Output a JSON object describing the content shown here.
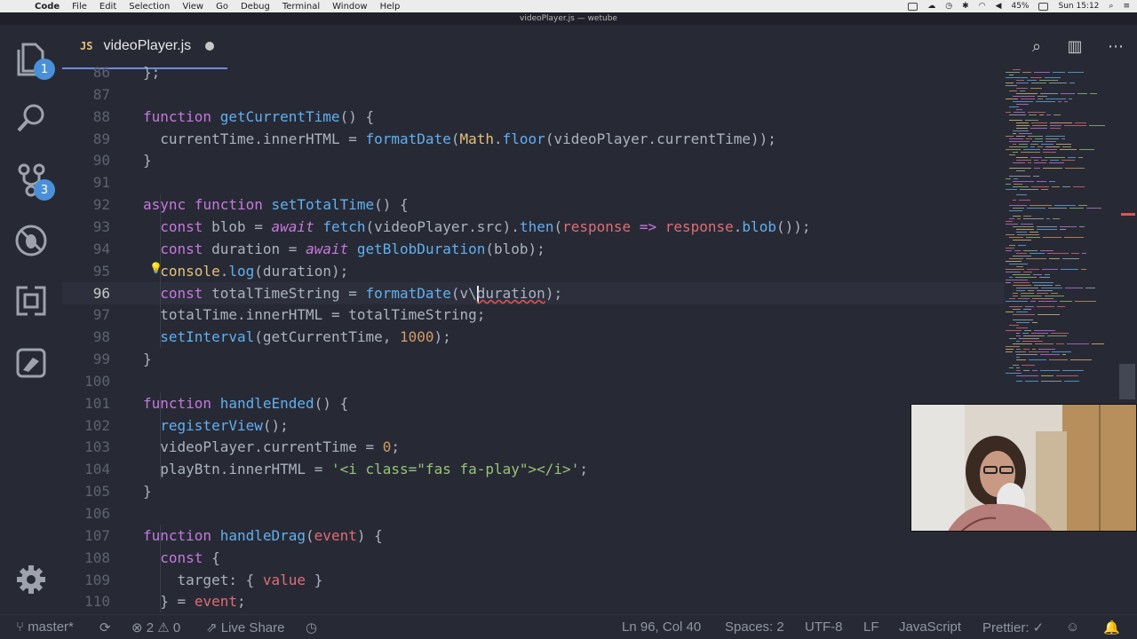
{
  "menubar": {
    "app": "Code",
    "items": [
      "File",
      "Edit",
      "Selection",
      "View",
      "Go",
      "Debug",
      "Terminal",
      "Window",
      "Help"
    ],
    "battery": "45%",
    "clock": "Sun 15:12"
  },
  "window_title": "videoPlayer.js — wetube",
  "tab": {
    "icon_label": "JS",
    "filename": "videoPlayer.js"
  },
  "activity": {
    "explorer_badge": "1",
    "scm_badge": "3"
  },
  "code_lines": [
    {
      "num": "86",
      "text": "};"
    },
    {
      "num": "87",
      "text": ""
    },
    {
      "num": "88",
      "text": "function getCurrentTime() {"
    },
    {
      "num": "89",
      "text": "  currentTime.innerHTML = formatDate(Math.floor(videoPlayer.currentTime));"
    },
    {
      "num": "90",
      "text": "}"
    },
    {
      "num": "91",
      "text": ""
    },
    {
      "num": "92",
      "text": "async function setTotalTime() {"
    },
    {
      "num": "93",
      "text": "  const blob = await fetch(videoPlayer.src).then(response => response.blob());"
    },
    {
      "num": "94",
      "text": "  const duration = await getBlobDuration(blob);"
    },
    {
      "num": "95",
      "text": "  console.log(duration);"
    },
    {
      "num": "96",
      "text": "  const totalTimeString = formatDate(v\\duration);"
    },
    {
      "num": "97",
      "text": "  totalTime.innerHTML = totalTimeString;"
    },
    {
      "num": "98",
      "text": "  setInterval(getCurrentTime, 1000);"
    },
    {
      "num": "99",
      "text": "}"
    },
    {
      "num": "100",
      "text": ""
    },
    {
      "num": "101",
      "text": "function handleEnded() {"
    },
    {
      "num": "102",
      "text": "  registerView();"
    },
    {
      "num": "103",
      "text": "  videoPlayer.currentTime = 0;"
    },
    {
      "num": "104",
      "text": "  playBtn.innerHTML = '<i class=\"fas fa-play\"></i>';"
    },
    {
      "num": "105",
      "text": "}"
    },
    {
      "num": "106",
      "text": ""
    },
    {
      "num": "107",
      "text": "function handleDrag(event) {"
    },
    {
      "num": "108",
      "text": "  const {"
    },
    {
      "num": "109",
      "text": "    target: { value }"
    },
    {
      "num": "110",
      "text": "  } = event;"
    }
  ],
  "current_line": "96",
  "statusbar": {
    "branch": "master*",
    "errors": "2",
    "warnings": "0",
    "live_share": "Live Share",
    "position": "Ln 96, Col 40",
    "spaces": "Spaces: 2",
    "encoding": "UTF-8",
    "eol": "LF",
    "language": "JavaScript",
    "prettier": "Prettier: ✓"
  },
  "colors": {
    "background": "#272a35",
    "keyword": "#c678dd",
    "function": "#61afef",
    "string": "#98c379",
    "number": "#d19a66",
    "variable": "#e06c75",
    "class": "#e5c07b",
    "badge": "#4a90d9"
  }
}
